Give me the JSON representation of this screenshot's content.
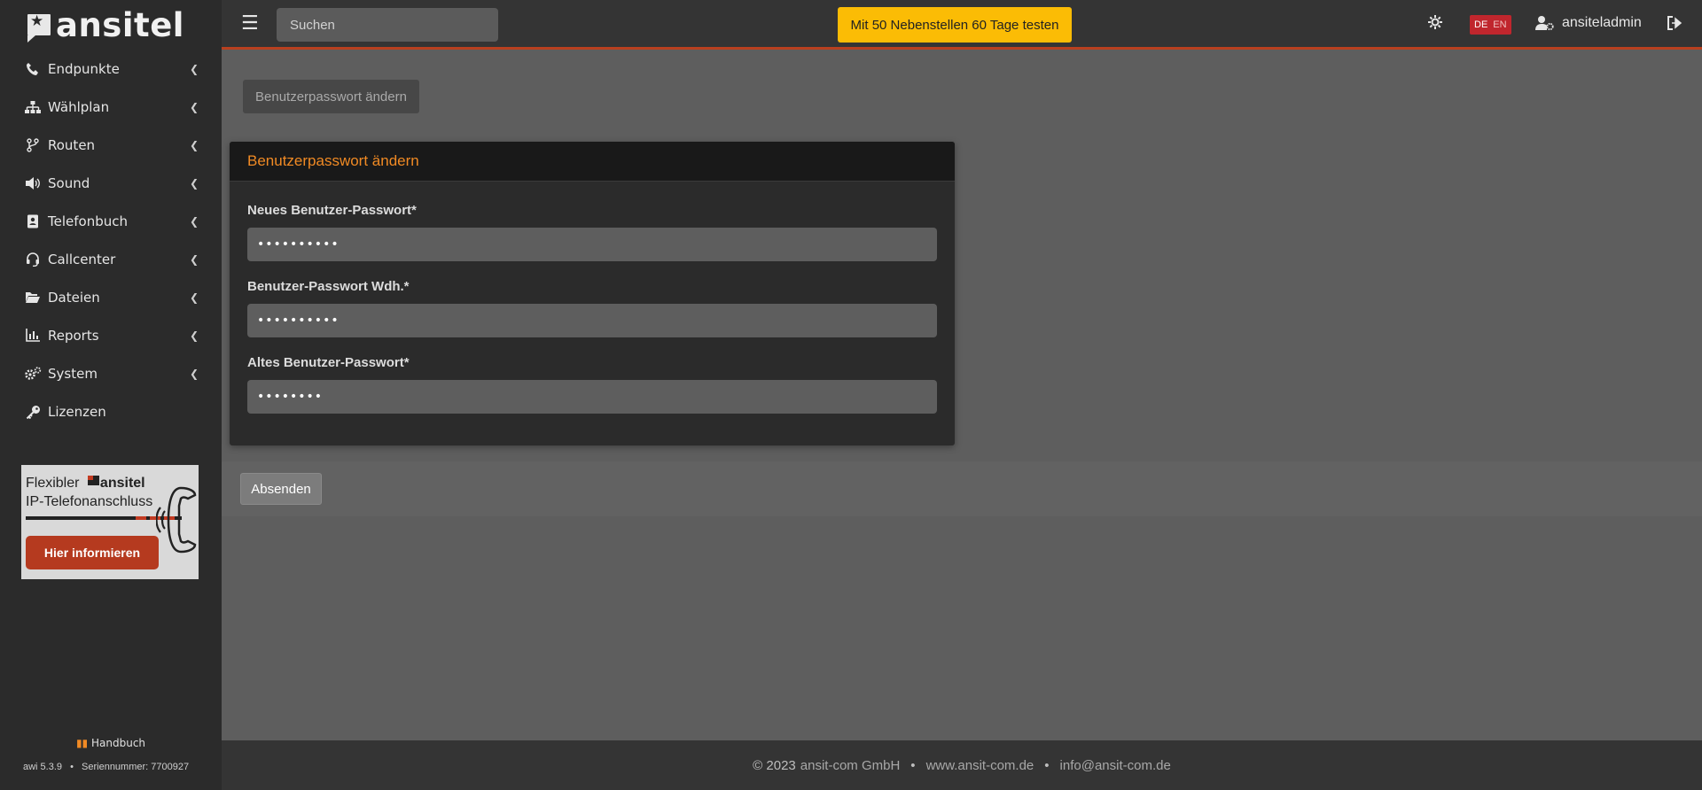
{
  "brand": {
    "name": "ansitel"
  },
  "topbar": {
    "search_placeholder": "Suchen",
    "trial_label": "Mit 50 Nebenstellen 60 Tage testen",
    "lang_de": "DE",
    "lang_en": "EN",
    "username": "ansiteladmin"
  },
  "sidebar": {
    "items": [
      {
        "label": "Endpunkte",
        "icon": "phone-icon"
      },
      {
        "label": "Wählplan",
        "icon": "sitemap-icon"
      },
      {
        "label": "Routen",
        "icon": "branch-icon"
      },
      {
        "label": "Sound",
        "icon": "volume-icon"
      },
      {
        "label": "Telefonbuch",
        "icon": "address-book-icon"
      },
      {
        "label": "Callcenter",
        "icon": "headset-icon"
      },
      {
        "label": "Dateien",
        "icon": "folder-open-icon"
      },
      {
        "label": "Reports",
        "icon": "chart-icon"
      },
      {
        "label": "System",
        "icon": "cogs-icon"
      },
      {
        "label": "Lizenzen",
        "icon": "key-icon"
      }
    ],
    "promo": {
      "line1_prefix": "Flexibler",
      "line1_brand": "ansitel",
      "line2": "IP-Telefonanschluss",
      "button": "Hier informieren"
    },
    "handbook": "Handbuch",
    "version": "awi 5.3.9",
    "serial": "Seriennummer: 7700927"
  },
  "breadcrumb": "Benutzerpasswort ändern",
  "form": {
    "title": "Benutzerpasswort ändern",
    "fields": [
      {
        "label": "Neues Benutzer-Passwort*",
        "value": "••••••••••"
      },
      {
        "label": "Benutzer-Passwort Wdh.*",
        "value": "••••••••••"
      },
      {
        "label": "Altes Benutzer-Passwort*",
        "value": "••••••••"
      }
    ],
    "submit": "Absenden"
  },
  "footer": {
    "copyright": "© 2023",
    "company": "ansit-com GmbH",
    "website": "www.ansit-com.de",
    "email": "info@ansit-com.de"
  },
  "colors": {
    "accent": "#f08a24",
    "trial": "#fbbc05",
    "lang": "#c0262d",
    "promo_button": "#b53a1f"
  }
}
